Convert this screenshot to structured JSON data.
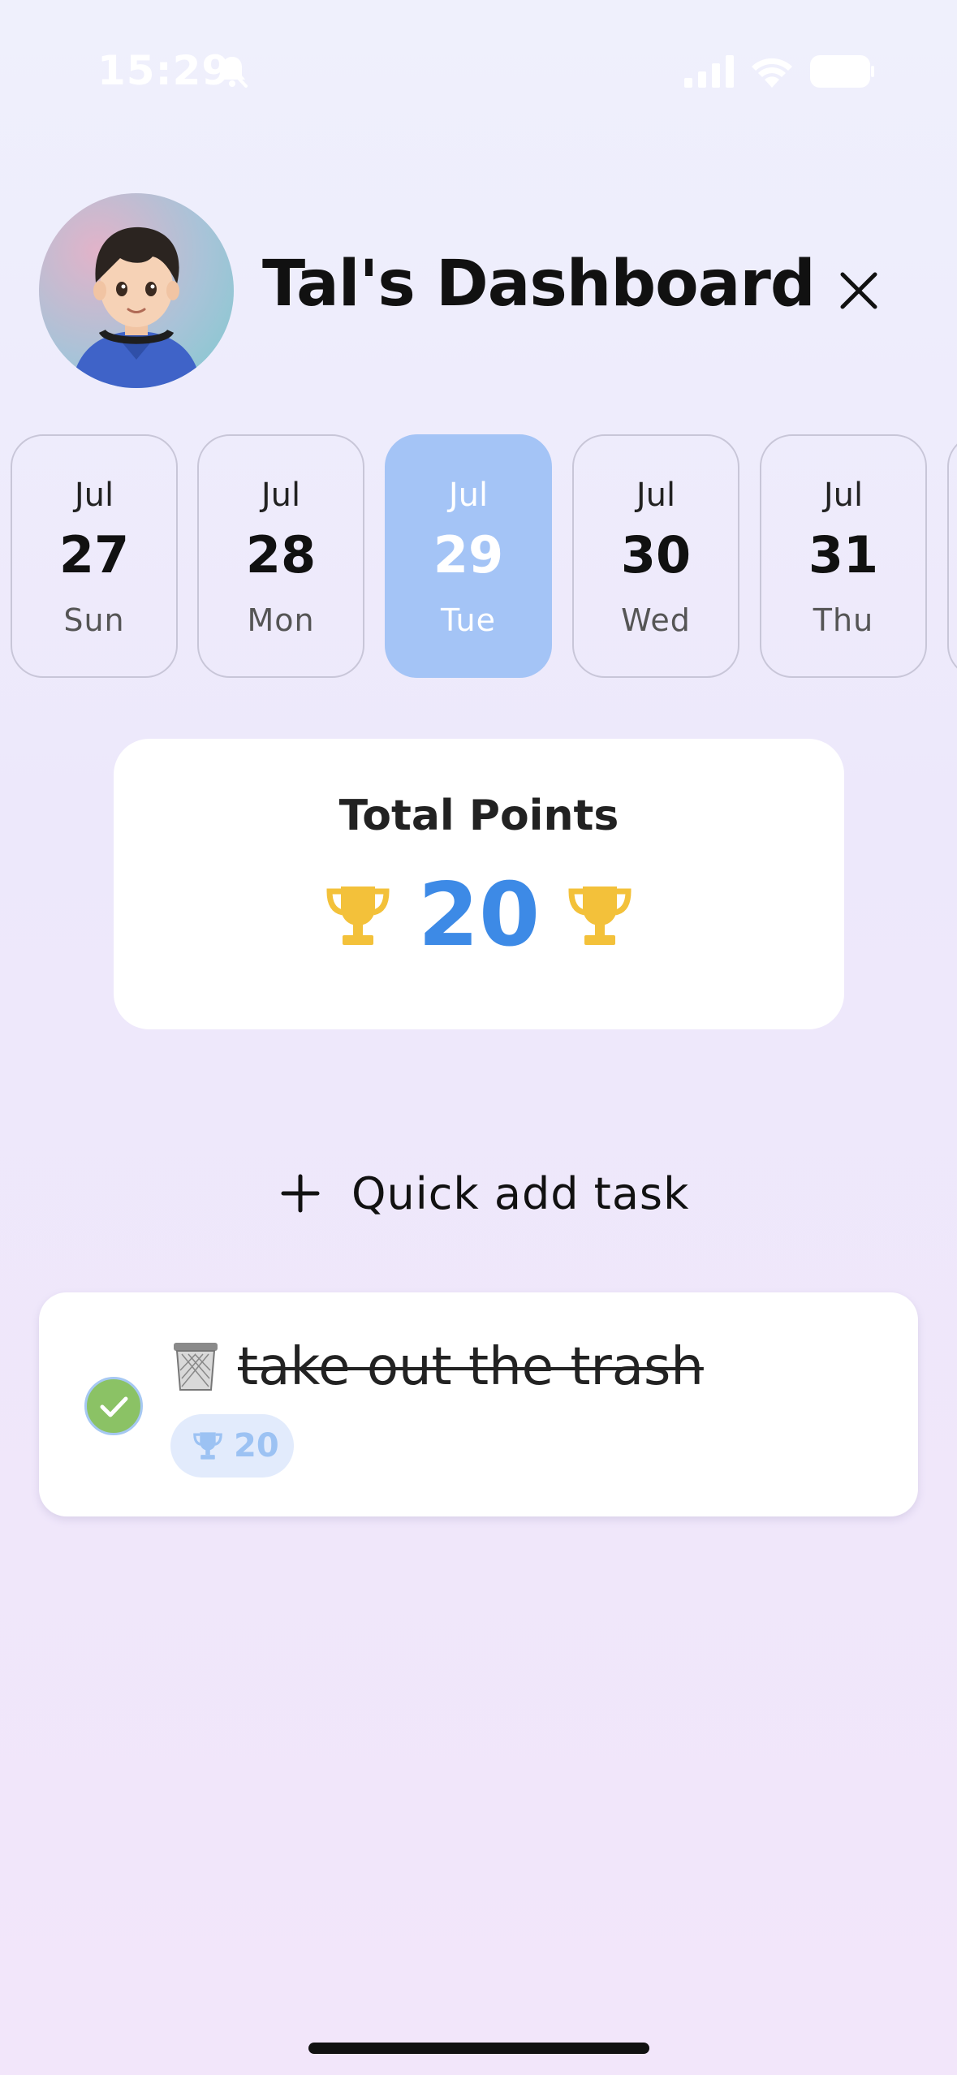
{
  "status_bar": {
    "time": "15:29",
    "icons": [
      "bell-slash-icon",
      "cellular-signal-icon",
      "wifi-icon",
      "battery-icon"
    ]
  },
  "header": {
    "title": "Tal's Dashboard",
    "avatar": "avatar",
    "close_icon": "close-icon"
  },
  "dates": [
    {
      "month": "Jul",
      "day": "27",
      "weekday": "Sun",
      "selected": false
    },
    {
      "month": "Jul",
      "day": "28",
      "weekday": "Mon",
      "selected": false
    },
    {
      "month": "Jul",
      "day": "29",
      "weekday": "Tue",
      "selected": true
    },
    {
      "month": "Jul",
      "day": "30",
      "weekday": "Wed",
      "selected": false
    },
    {
      "month": "Jul",
      "day": "31",
      "weekday": "Thu",
      "selected": false
    }
  ],
  "points": {
    "label": "Total Points",
    "value": "20",
    "icon": "trophy-icon"
  },
  "quick_add": {
    "label": "Quick add task",
    "icon": "plus-icon"
  },
  "tasks": [
    {
      "emoji": "🗑️",
      "title": "take out the trash",
      "completed": true,
      "points": "20"
    }
  ],
  "colors": {
    "accent_blue": "#3d8ae6",
    "selected_date_bg": "#a4c4f6",
    "trophy_gold": "#f3c13a",
    "check_green": "#8bc265",
    "badge_bg": "#e2ebfc"
  }
}
